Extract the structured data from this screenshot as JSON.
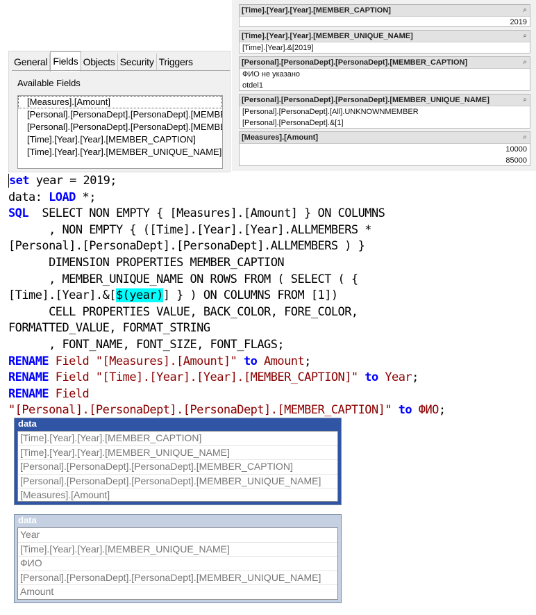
{
  "properties_dialog": {
    "tabs": [
      "General",
      "Fields",
      "Objects",
      "Security",
      "Triggers"
    ],
    "available_fields_label": "Available Fields",
    "fields": [
      "[Measures].[Amount]",
      "[Personal].[PersonaDept].[PersonaDept].[MEMBER_CAPTION]",
      "[Personal].[PersonaDept].[PersonaDept].[MEMBER_UNIQUE_NAME]",
      "[Time].[Year].[Year].[MEMBER_CAPTION]",
      "[Time].[Year].[Year].[MEMBER_UNIQUE_NAME]"
    ]
  },
  "field_panels": [
    {
      "title": "[Time].[Year].[Year].[MEMBER_CAPTION]",
      "values": [
        "2019"
      ],
      "numeric": true
    },
    {
      "title": "[Time].[Year].[Year].[MEMBER_UNIQUE_NAME]",
      "values": [
        "[Time].[Year].&[2019]"
      ],
      "numeric": false
    },
    {
      "title": "[Personal].[PersonaDept].[PersonaDept].[MEMBER_CAPTION]",
      "values": [
        "ФИО не указано",
        "otdel1"
      ],
      "numeric": false
    },
    {
      "title": "[Personal].[PersonaDept].[PersonaDept].[MEMBER_UNIQUE_NAME]",
      "values": [
        "[Personal].[PersonaDept].[All].UNKNOWNMEMBER",
        "[Personal].[PersonaDept].&[1]"
      ],
      "numeric": false
    },
    {
      "title": "[Measures].[Amount]",
      "values": [
        "10000",
        "85000"
      ],
      "numeric": true
    }
  ],
  "search_icon_glyph": "⌕",
  "script_lines": [
    [
      {
        "t": "set",
        "c": "kw"
      },
      {
        "t": " year = 2019;",
        "c": ""
      }
    ],
    [
      {
        "t": "data: ",
        "c": ""
      },
      {
        "t": "LOAD",
        "c": "kw"
      },
      {
        "t": " *;",
        "c": ""
      }
    ],
    [
      {
        "t": "SQL",
        "c": "kw"
      },
      {
        "t": "  SELECT NON EMPTY { [Measures].[Amount] } ON COLUMNS",
        "c": ""
      }
    ],
    [
      {
        "t": "      , NON EMPTY { ([Time].[Year].[Year].ALLMEMBERS *",
        "c": ""
      }
    ],
    [
      {
        "t": "[Personal].[PersonaDept].[PersonaDept].ALLMEMBERS ) }",
        "c": ""
      }
    ],
    [
      {
        "t": "      DIMENSION PROPERTIES MEMBER_CAPTION",
        "c": ""
      }
    ],
    [
      {
        "t": "      , MEMBER_UNIQUE_NAME ON ROWS FROM ( SELECT ( {",
        "c": ""
      }
    ],
    [
      {
        "t": "[Time].[Year].&[",
        "c": ""
      },
      {
        "t": "$(year)",
        "c": "hl"
      },
      {
        "t": "] } ) ON COLUMNS FROM [1])",
        "c": ""
      }
    ],
    [
      {
        "t": "      CELL PROPERTIES VALUE, BACK_COLOR, FORE_COLOR,",
        "c": ""
      }
    ],
    [
      {
        "t": "FORMATTED_VALUE, FORMAT_STRING",
        "c": ""
      }
    ],
    [
      {
        "t": "      , FONT_NAME, FONT_SIZE, FONT_FLAGS;",
        "c": ""
      }
    ],
    [
      {
        "t": "RENAME",
        "c": "kw"
      },
      {
        "t": " Field ",
        "c": "str"
      },
      {
        "t": "\"[Measures].[Amount]\"",
        "c": "str"
      },
      {
        "t": " to",
        "c": "kw"
      },
      {
        "t": " Amount",
        "c": "str"
      },
      {
        "t": ";",
        "c": ""
      }
    ],
    [
      {
        "t": "RENAME",
        "c": "kw"
      },
      {
        "t": " Field ",
        "c": "str"
      },
      {
        "t": "\"[Time].[Year].[Year].[MEMBER_CAPTION]\"",
        "c": "str"
      },
      {
        "t": " to",
        "c": "kw"
      },
      {
        "t": " Year",
        "c": "str"
      },
      {
        "t": ";",
        "c": ""
      }
    ],
    [
      {
        "t": "RENAME",
        "c": "kw"
      },
      {
        "t": " Field",
        "c": "str"
      }
    ],
    [
      {
        "t": "\"[Personal].[PersonaDept].[PersonaDept].[MEMBER_CAPTION]\"",
        "c": "str"
      },
      {
        "t": " to",
        "c": "kw"
      },
      {
        "t": " ФИО",
        "c": "str"
      },
      {
        "t": ";",
        "c": ""
      }
    ]
  ],
  "table_before": {
    "title": "data",
    "fields": [
      "[Time].[Year].[Year].[MEMBER_CAPTION]",
      "[Time].[Year].[Year].[MEMBER_UNIQUE_NAME]",
      "[Personal].[PersonaDept].[PersonaDept].[MEMBER_CAPTION]",
      "[Personal].[PersonaDept].[PersonaDept].[MEMBER_UNIQUE_NAME]",
      "[Measures].[Amount]"
    ]
  },
  "table_after": {
    "title": "data",
    "fields": [
      "Year",
      "[Time].[Year].[Year].[MEMBER_UNIQUE_NAME]",
      "ФИО",
      "[Personal].[PersonaDept].[PersonaDept].[MEMBER_UNIQUE_NAME]",
      "Amount"
    ]
  },
  "colors": {
    "keyword": "#0000ff",
    "string": "#8b0000",
    "highlight": "#00ffff",
    "table_active_header": "#2f55a4",
    "table_inactive_header": "#c5d1e3"
  }
}
